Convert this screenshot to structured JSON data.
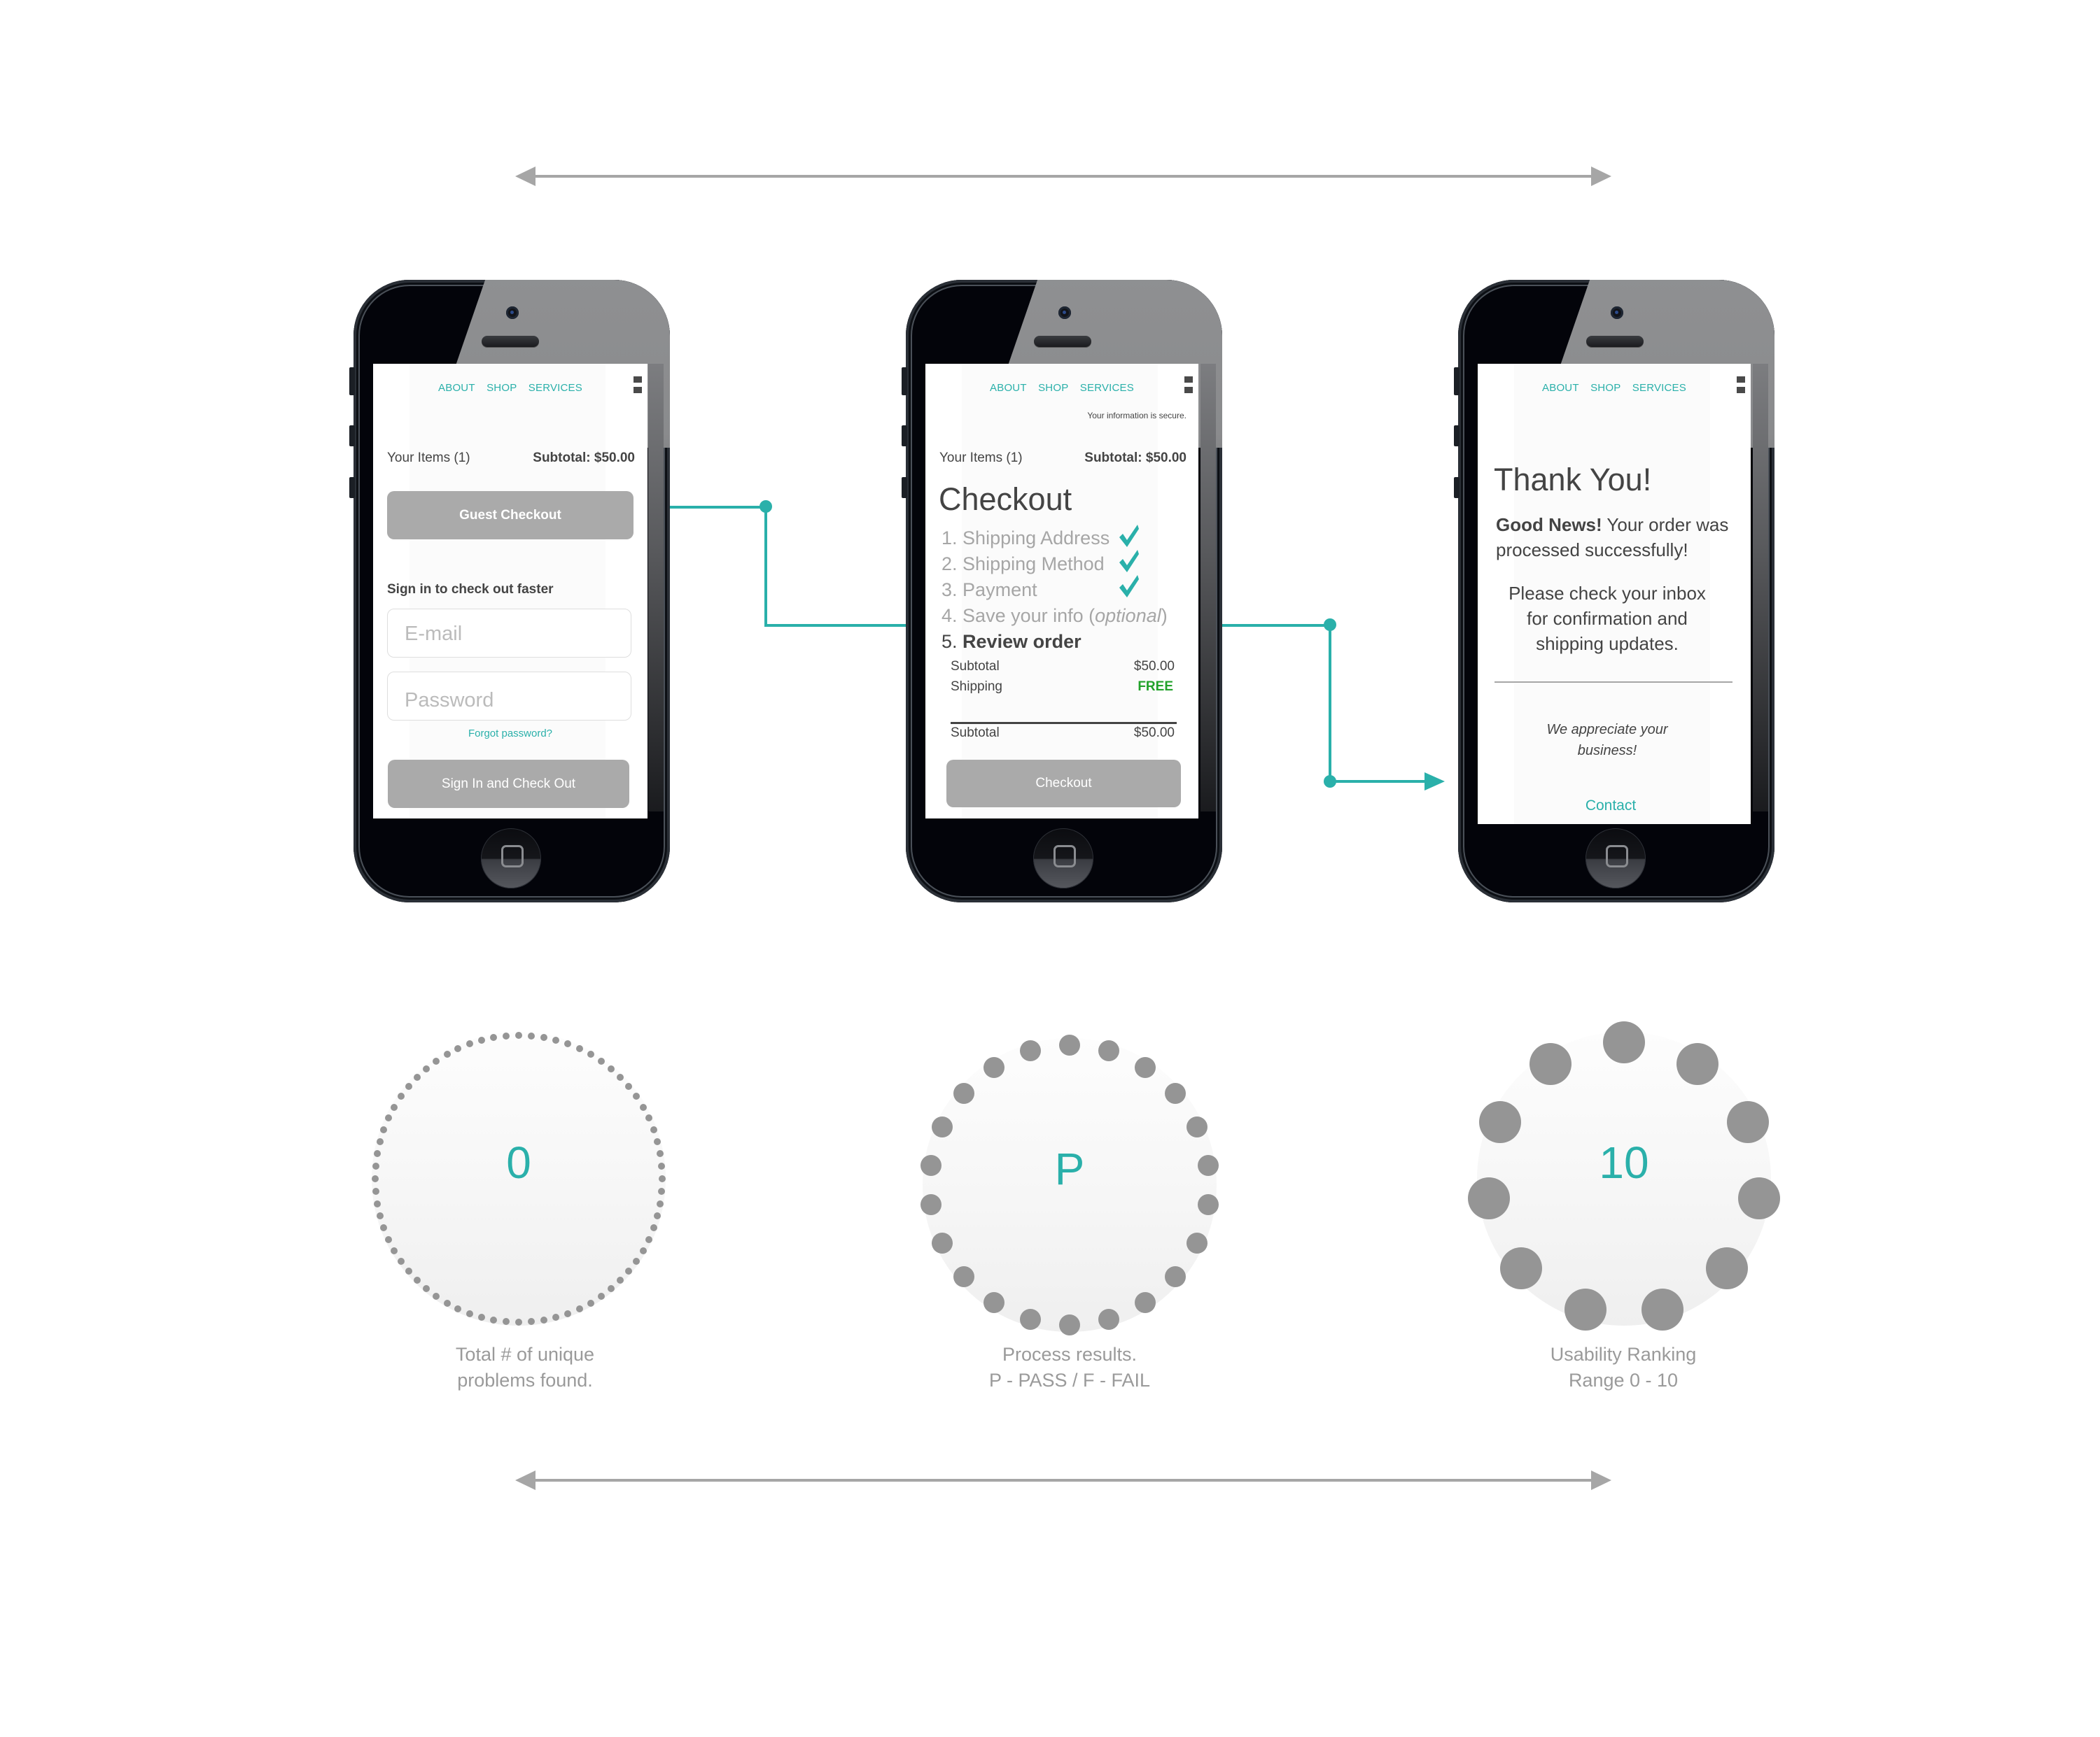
{
  "colors": {
    "accent": "#2ab0aa",
    "button_gray": "#aaaaaa",
    "free_green": "#22a22a",
    "arrow_gray": "#a6a6a6",
    "dot_gray": "#959595"
  },
  "nav": {
    "items": [
      "ABOUT",
      "SHOP",
      "SERVICES"
    ]
  },
  "screens": [
    {
      "name": "cart-signin",
      "items_label": "Your Items (1)",
      "subtotal_label": "Subtotal: $50.00",
      "guest_checkout_button": "Guest Checkout",
      "signin_heading": "Sign in to check out faster",
      "email_placeholder": "E-mail",
      "password_placeholder": "Password",
      "forgot_password_link": "Forgot password?",
      "signin_button": "Sign In and Check Out"
    },
    {
      "name": "checkout-review",
      "secure_note": "Your information is secure.",
      "items_label": "Your Items (1)",
      "subtotal_label": "Subtotal: $50.00",
      "title": "Checkout",
      "steps": [
        {
          "num": "1.",
          "label": "Shipping Address",
          "done": true
        },
        {
          "num": "2.",
          "label": "Shipping Method",
          "done": true
        },
        {
          "num": "3.",
          "label": "Payment",
          "done": true
        },
        {
          "num": "4.",
          "label": "Save your info (",
          "label_italic": "optional",
          "label_end": ")",
          "done": false
        },
        {
          "num": "5.",
          "label": "Review order",
          "current": true
        }
      ],
      "summary": [
        {
          "label": "Subtotal",
          "value": "$50.00"
        },
        {
          "label": "Shipping",
          "value": "FREE"
        }
      ],
      "total": {
        "label": "Subtotal",
        "value": "$50.00"
      },
      "checkout_button": "Checkout"
    },
    {
      "name": "confirmation",
      "title": "Thank You!",
      "good_news_bold": "Good News!",
      "good_news_rest": " Your order was processed successfully!",
      "inbox_note": "Please check your inbox for confirmation and shipping updates.",
      "appreciation": "We appreciate your business!",
      "contact_link": "Contact"
    }
  ],
  "metrics": [
    {
      "value": "0",
      "caption_line1": "Total # of unique",
      "caption_line2": "problems found."
    },
    {
      "value": "P",
      "caption_line1": "Process results.",
      "caption_line2": "P - PASS / F - FAIL"
    },
    {
      "value": "10",
      "caption_line1": "Usability Ranking",
      "caption_line2": "Range 0 - 10"
    }
  ]
}
